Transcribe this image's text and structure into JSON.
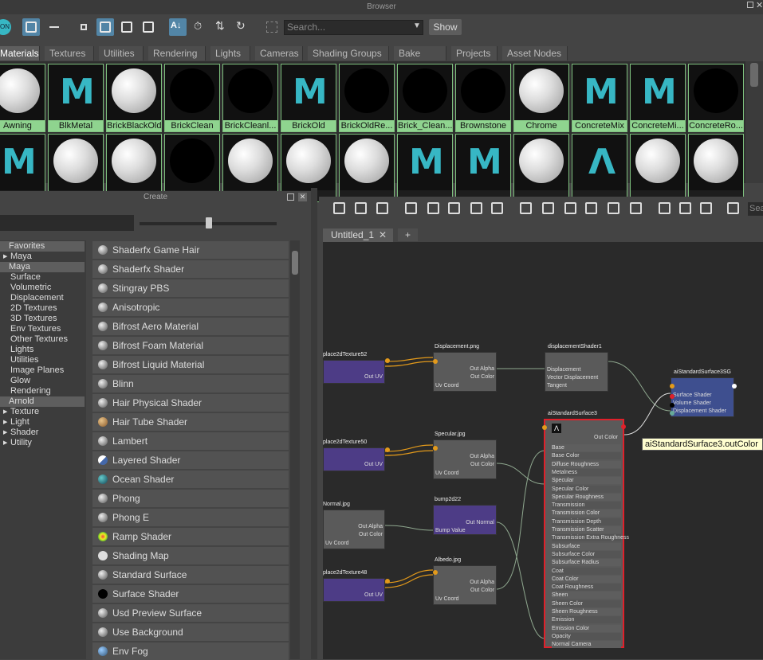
{
  "window": {
    "title": "Browser"
  },
  "toolbar": {
    "search_placeholder": "Search...",
    "show_label": "Show",
    "left_badge": "ON"
  },
  "tabs": [
    "Materials",
    "Textures",
    "Utilities",
    "Rendering",
    "Lights",
    "Cameras",
    "Shading Groups",
    "Bake Sets",
    "Projects",
    "Asset Nodes"
  ],
  "swatches_row1": [
    {
      "label": "Awning",
      "thumb": "white-sphere"
    },
    {
      "label": "BlkMetal",
      "thumb": "maya-logo"
    },
    {
      "label": "BrickBlackOld",
      "thumb": "white-sphere"
    },
    {
      "label": "BrickClean",
      "thumb": "black-sphere"
    },
    {
      "label": "BrickCleanl...",
      "thumb": "black-sphere"
    },
    {
      "label": "BrickOld",
      "thumb": "maya-logo"
    },
    {
      "label": "BrickOldRe...",
      "thumb": "black-sphere"
    },
    {
      "label": "Brick_Clean...",
      "thumb": "black-sphere"
    },
    {
      "label": "Brownstone",
      "thumb": "black-sphere"
    },
    {
      "label": "Chrome",
      "thumb": "white-sphere"
    },
    {
      "label": "ConcreteMix",
      "thumb": "maya-logo"
    },
    {
      "label": "ConcreteMi...",
      "thumb": "maya-logo"
    },
    {
      "label": "ConcreteRo...",
      "thumb": "black-sphere"
    }
  ],
  "swatches_row2": [
    "maya-logo",
    "white-sphere",
    "white-sphere",
    "black-sphere",
    "white-sphere",
    "white-sphere",
    "white-sphere",
    "maya-logo",
    "maya-logo",
    "white-sphere",
    "arnold-logo",
    "white-sphere",
    "white-sphere"
  ],
  "create": {
    "title": "Create"
  },
  "tree": [
    {
      "label": "Favorites",
      "header": true
    },
    {
      "label": "Maya",
      "arrow": true
    },
    {
      "label": "Maya",
      "header": true
    },
    {
      "label": "Surface"
    },
    {
      "label": "Volumetric"
    },
    {
      "label": "Displacement"
    },
    {
      "label": "2D Textures"
    },
    {
      "label": "3D Textures"
    },
    {
      "label": "Env Textures"
    },
    {
      "label": "Other Textures"
    },
    {
      "label": "Lights"
    },
    {
      "label": "Utilities"
    },
    {
      "label": "Image Planes"
    },
    {
      "label": "Glow"
    },
    {
      "label": "Rendering"
    },
    {
      "label": "Arnold",
      "header": true
    },
    {
      "label": "Texture",
      "arrow": true
    },
    {
      "label": "Light",
      "arrow": true
    },
    {
      "label": "Shader",
      "arrow": true
    },
    {
      "label": "Utility",
      "arrow": true
    }
  ],
  "shaders": [
    "Shaderfx Game Hair",
    "Shaderfx Shader",
    "Stingray PBS",
    "Anisotropic",
    "Bifrost Aero Material",
    "Bifrost Foam Material",
    "Bifrost Liquid Material",
    "Blinn",
    "Hair Physical Shader",
    "Hair Tube Shader",
    "Lambert",
    "Layered Shader",
    "Ocean Shader",
    "Phong",
    "Phong E",
    "Ramp Shader",
    "Shading Map",
    "Standard Surface",
    "Surface Shader",
    "Usd Preview Surface",
    "Use Background",
    "Env Fog"
  ],
  "graph": {
    "tab_label": "Untitled_1",
    "plus": "+",
    "tooltip": "aiStandardSurface3.outColor",
    "nodes": {
      "place52": {
        "title": "place2dTexture52",
        "out": "Out UV"
      },
      "place50": {
        "title": "place2dTexture50",
        "out": "Out UV"
      },
      "place48": {
        "title": "place2dTexture48",
        "out": "Out UV"
      },
      "displacement_png": {
        "title": "Displacement.png",
        "rows": [
          "Out Alpha",
          "Out Color",
          "Uv Coord"
        ]
      },
      "specular_jpg": {
        "title": "Specular.jpg",
        "rows": [
          "Out Alpha",
          "Out Color",
          "Uv Coord"
        ]
      },
      "normal_jpg": {
        "title": "Normal.jpg",
        "rows": [
          "Out Alpha",
          "Out Color",
          "Uv Coord"
        ]
      },
      "albedo_jpg": {
        "title": "Albedo.jpg",
        "rows": [
          "Out Alpha",
          "Out Color",
          "Uv Coord"
        ]
      },
      "bump": {
        "title": "bump2d22",
        "rows": [
          "Out Normal",
          "Bump Value"
        ]
      },
      "dispShader": {
        "title": "displacementShader1",
        "rows": [
          "Displacement",
          "Vector Displacement",
          "Tangent"
        ]
      },
      "sg": {
        "title": "aiStandardSurface3SG",
        "rows": [
          "Surface Shader",
          "Volume Shader",
          "Displacement Shader"
        ]
      },
      "ai": {
        "title": "aiStandardSurface3",
        "out": "Out Color",
        "rows": [
          "Base",
          "Base Color",
          "Diffuse Roughness",
          "Metalness",
          "Specular",
          "Specular Color",
          "Specular Roughness",
          "Transmission",
          "Transmission Color",
          "Transmission Depth",
          "Transmission Scatter",
          "Transmission Extra Roughness",
          "Subsurface",
          "Subsurface Color",
          "Subsurface Radius",
          "Coat",
          "Coat Color",
          "Coat Roughness",
          "Sheen",
          "Sheen Color",
          "Sheen Roughness",
          "Emission",
          "Emission Color",
          "Opacity",
          "Normal Camera"
        ]
      }
    }
  },
  "colors": {
    "accent": "#5285a6",
    "swatch_border": "#8fd48f",
    "node_purple": "#4d3c86",
    "selection_red": "#e0202a",
    "maya_teal": "#37b7c4"
  }
}
